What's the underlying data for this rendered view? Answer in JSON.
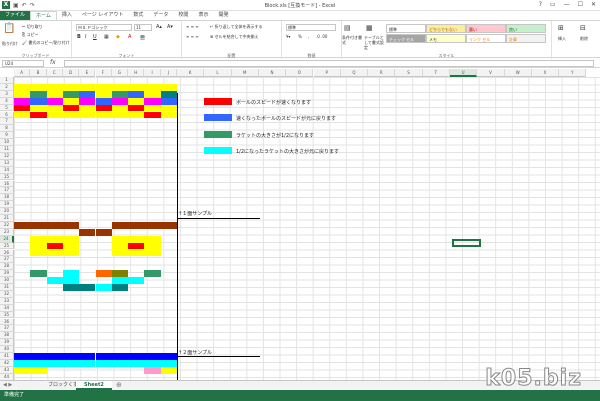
{
  "window": {
    "title": "Block.xls [互換モード] - Excel",
    "app_icon": "excel-icon",
    "controls": [
      "?",
      "▭",
      "—",
      "☐",
      "✕"
    ]
  },
  "quick_access": [
    "save-icon",
    "undo-icon",
    "redo-icon"
  ],
  "ribbon_tabs": [
    "ファイル",
    "ホーム",
    "挿入",
    "ページ レイアウト",
    "数式",
    "データ",
    "校閲",
    "表示",
    "開発"
  ],
  "ribbon": {
    "clipboard": {
      "label": "クリップボード",
      "paste": "貼り付け",
      "cut": "切り取り",
      "copy": "コピー",
      "format_painter": "書式のコピー/貼り付け"
    },
    "font": {
      "label": "フォント",
      "name": "ＭＳ Ｐゴシック",
      "size": "11",
      "bold": "B",
      "italic": "I",
      "underline": "U"
    },
    "alignment": {
      "label": "配置",
      "wrap": "折り返して全体を表示する",
      "merge": "セルを結合して中央揃え"
    },
    "number": {
      "label": "数値",
      "format": "標準",
      "percent": "%",
      "comma": ","
    },
    "styles": {
      "label": "スタイル",
      "conditional": "条件付き書式",
      "table": "テーブルとして書式設定",
      "cells": [
        {
          "text": "標準",
          "bg": "#ffffff",
          "fg": "#000000"
        },
        {
          "text": "どちらでもない",
          "bg": "#ffeb9c",
          "fg": "#9c6500"
        },
        {
          "text": "悪い",
          "bg": "#ffc7ce",
          "fg": "#9c0006"
        },
        {
          "text": "良い",
          "bg": "#c6efce",
          "fg": "#006100"
        },
        {
          "text": "チェック セル",
          "bg": "#a5a5a5",
          "fg": "#ffffff"
        },
        {
          "text": "メモ",
          "bg": "#ffffcc",
          "fg": "#000000"
        },
        {
          "text": "リンク セル",
          "bg": "#ffffff",
          "fg": "#fa7d00"
        },
        {
          "text": "計算",
          "bg": "#f2f2f2",
          "fg": "#fa7d00"
        }
      ]
    },
    "cells_group": {
      "insert": "挿入",
      "delete": "削除"
    }
  },
  "formula_bar": {
    "name_box": "U24",
    "fx": "fx",
    "value": ""
  },
  "columns": [
    "A",
    "B",
    "C",
    "D",
    "E",
    "F",
    "G",
    "H",
    "I",
    "J",
    "K",
    "L",
    "M",
    "N",
    "O",
    "P",
    "Q",
    "R",
    "S",
    "T",
    "U",
    "V",
    "W",
    "X",
    "Y"
  ],
  "selected_column": "U",
  "selected_row": 24,
  "rows": 44,
  "legend": [
    {
      "color": "#ff0000",
      "text": "ボールのスピードが速くなります"
    },
    {
      "color": "#3366ff",
      "text": "速くなったボールのスピードが元に戻ります"
    },
    {
      "color": "#339966",
      "text": "ラケットの大きさが1/2になります"
    },
    {
      "color": "#00ffff",
      "text": "1/2になったラケットの大きさが元に戻ります"
    }
  ],
  "labels": {
    "sample1": "↑１面サンプル",
    "sample2": "↑２面サンプル"
  },
  "sheets": [
    "ブロックくずし",
    "Sheet2"
  ],
  "active_sheet": "Sheet2",
  "status": "準備完了",
  "watermark": "k05.biz",
  "colors": {
    "excel_green": "#217346",
    "red": "#ff0000",
    "blue": "#3366ff",
    "green": "#339966",
    "cyan": "#00ffff",
    "yellow": "#ffff00",
    "magenta": "#ff00ff",
    "brown": "#993300",
    "orange": "#ff6600",
    "olive": "#808000",
    "teal": "#008080",
    "navy_blue": "#0000ff",
    "pink": "#ff99cc"
  }
}
